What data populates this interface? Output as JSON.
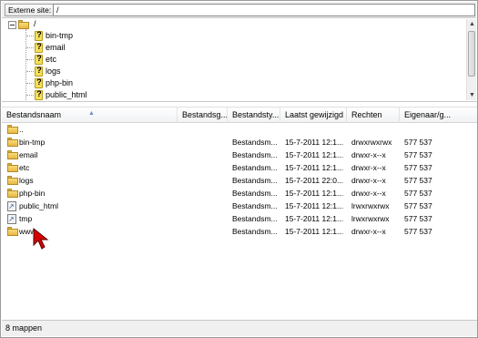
{
  "address_bar": {
    "label": "Externe site:",
    "path": "/"
  },
  "tree": {
    "root_label": "/",
    "items": [
      {
        "label": "bin-tmp",
        "icon": "unknown-folder-icon"
      },
      {
        "label": "email",
        "icon": "unknown-folder-icon"
      },
      {
        "label": "etc",
        "icon": "unknown-folder-icon"
      },
      {
        "label": "logs",
        "icon": "unknown-folder-icon"
      },
      {
        "label": "php-bin",
        "icon": "unknown-folder-icon"
      },
      {
        "label": "public_html",
        "icon": "unknown-folder-icon"
      }
    ]
  },
  "columns": [
    "Bestandsnaam",
    "Bestandsg...",
    "Bestandsty...",
    "Laatst gewijzigd",
    "Rechten",
    "Eigenaar/g..."
  ],
  "rows": [
    {
      "name": "..",
      "size": "",
      "type": "",
      "modified": "",
      "perms": "",
      "owner": "",
      "icon": "folder-icon"
    },
    {
      "name": "bin-tmp",
      "size": "",
      "type": "Bestandsm...",
      "modified": "15-7-2011 12:1...",
      "perms": "drwxrwxrwx",
      "owner": "577 537",
      "icon": "folder-icon"
    },
    {
      "name": "email",
      "size": "",
      "type": "Bestandsm...",
      "modified": "15-7-2011 12:1...",
      "perms": "drwxr-x--x",
      "owner": "577 537",
      "icon": "folder-icon"
    },
    {
      "name": "etc",
      "size": "",
      "type": "Bestandsm...",
      "modified": "15-7-2011 12:1...",
      "perms": "drwxr-x--x",
      "owner": "577 537",
      "icon": "folder-icon"
    },
    {
      "name": "logs",
      "size": "",
      "type": "Bestandsm...",
      "modified": "15-7-2011 22:0...",
      "perms": "drwxr-x--x",
      "owner": "577 537",
      "icon": "folder-icon"
    },
    {
      "name": "php-bin",
      "size": "",
      "type": "Bestandsm...",
      "modified": "15-7-2011 12:1...",
      "perms": "drwxr-x--x",
      "owner": "577 537",
      "icon": "folder-icon"
    },
    {
      "name": "public_html",
      "size": "",
      "type": "Bestandsm...",
      "modified": "15-7-2011 12:1...",
      "perms": "lrwxrwxrwx",
      "owner": "577 537",
      "icon": "symlink-icon"
    },
    {
      "name": "tmp",
      "size": "",
      "type": "Bestandsm...",
      "modified": "15-7-2011 12:1...",
      "perms": "lrwxrwxrwx",
      "owner": "577 537",
      "icon": "symlink-icon"
    },
    {
      "name": "www",
      "size": "",
      "type": "Bestandsm...",
      "modified": "15-7-2011 12:1...",
      "perms": "drwxr-x--x",
      "owner": "577 537",
      "icon": "folder-icon"
    }
  ],
  "status": {
    "text": "8 mappen"
  },
  "colors": {
    "folder": "#e8b843",
    "cursor": "#d40000"
  }
}
